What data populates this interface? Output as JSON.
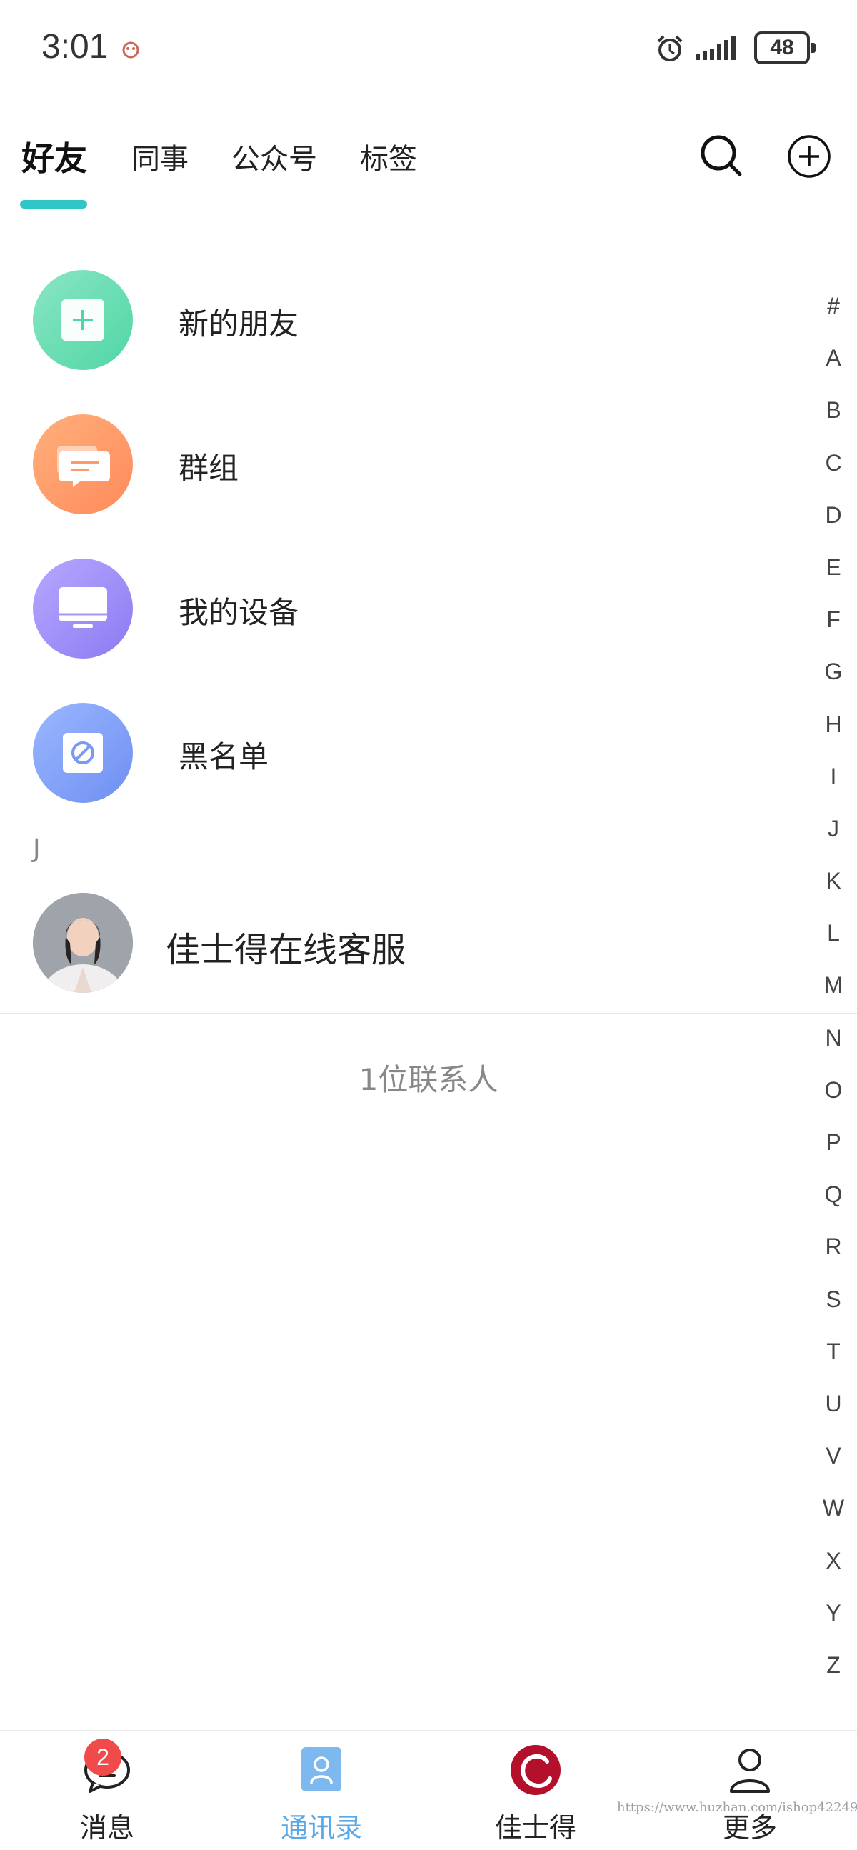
{
  "status_bar": {
    "time": "3:01",
    "battery": "48"
  },
  "tabs": [
    {
      "label": "好友",
      "active": true
    },
    {
      "label": "同事",
      "active": false
    },
    {
      "label": "公众号",
      "active": false
    },
    {
      "label": "标签",
      "active": false
    }
  ],
  "top_actions": {
    "search_icon": "search-icon",
    "add_icon": "plus-circle-icon"
  },
  "functions": [
    {
      "label": "新的朋友",
      "icon": "add-friend-icon",
      "color_from": "#8ae6c4",
      "color_to": "#4fd6a4"
    },
    {
      "label": "群组",
      "icon": "group-chat-icon",
      "color_from": "#ffb07c",
      "color_to": "#ff8a5a"
    },
    {
      "label": "我的设备",
      "icon": "monitor-icon",
      "color_from": "#b7a8ff",
      "color_to": "#8a7bf2"
    },
    {
      "label": "黑名单",
      "icon": "block-icon",
      "color_from": "#9ab7ff",
      "color_to": "#6f8ff2"
    }
  ],
  "section": {
    "letter": "J"
  },
  "contacts": [
    {
      "name": "佳士得在线客服"
    }
  ],
  "contact_count": "1位联系人",
  "alphabet": [
    "#",
    "A",
    "B",
    "C",
    "D",
    "E",
    "F",
    "G",
    "H",
    "I",
    "J",
    "K",
    "L",
    "M",
    "N",
    "O",
    "P",
    "Q",
    "R",
    "S",
    "T",
    "U",
    "V",
    "W",
    "X",
    "Y",
    "Z"
  ],
  "bottom_nav": [
    {
      "label": "消息",
      "icon": "chat-bubble-icon",
      "badge": "2",
      "active": false
    },
    {
      "label": "通讯录",
      "icon": "contacts-icon",
      "active": true
    },
    {
      "label": "佳士得",
      "icon": "brand-logo-icon",
      "active": false
    },
    {
      "label": "更多",
      "icon": "person-icon",
      "active": false
    }
  ],
  "watermark": "https://www.huzhan.com/ishop42249",
  "colors": {
    "accent": "#2ec6c6",
    "nav_active": "#5aa9e6",
    "badge": "#f04a4a"
  }
}
